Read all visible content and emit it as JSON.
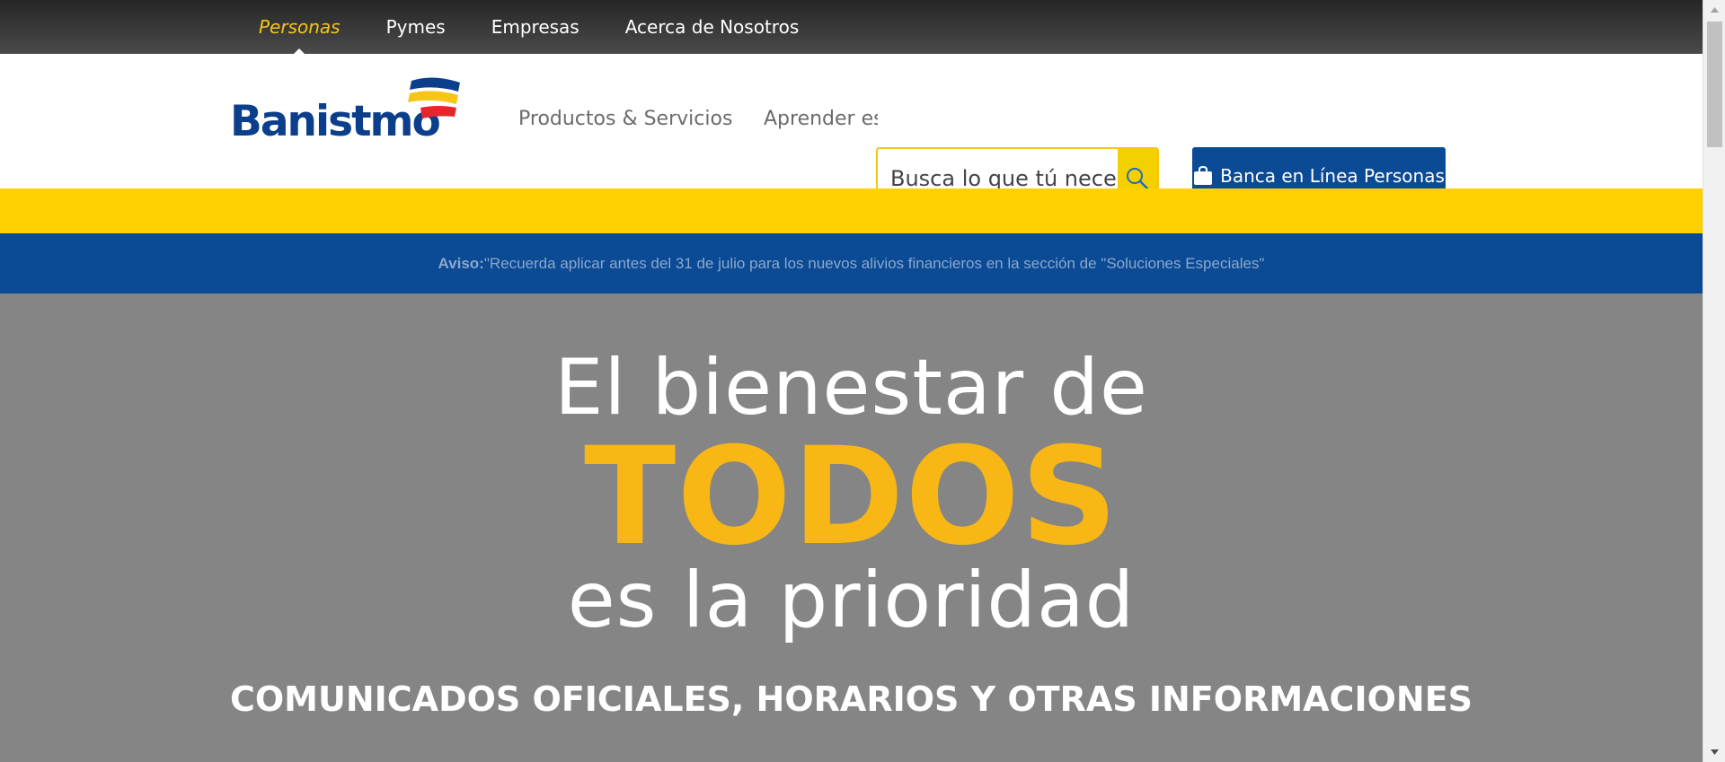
{
  "topnav": {
    "items": [
      "Personas",
      "Pymes",
      "Empresas",
      "Acerca de Nosotros"
    ],
    "active": "Personas"
  },
  "header": {
    "logo_text": "Banistmo",
    "nav": [
      "Productos & Servicios",
      "Aprender es"
    ],
    "search_placeholder": "Busca lo que tú necesitas",
    "banca_label": "Banca en Línea Personas"
  },
  "notice": {
    "label": "Aviso:",
    "text": "\"Recuerda aplicar antes del 31 de julio para los nuevos alivios financieros en la sección de \"Soluciones Especiales\""
  },
  "hero": {
    "line1": "El bienestar de",
    "line2": "TODOS",
    "line3": "es la prioridad",
    "subtitle": "COMUNICADOS OFICIALES, HORARIOS Y OTRAS INFORMACIONES"
  },
  "colors": {
    "brand_blue": "#0b4a94",
    "brand_yellow": "#ffd100",
    "accent_yellow": "#f9b715",
    "topbar": "#333333"
  },
  "icons": {
    "search": "search-icon",
    "banca": "briefcase-icon"
  }
}
